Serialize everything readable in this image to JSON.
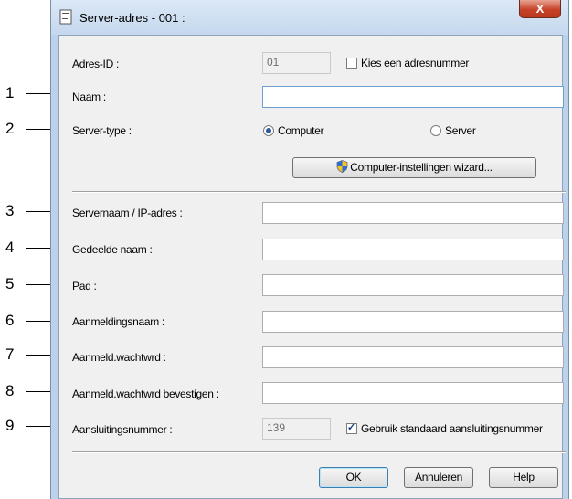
{
  "window": {
    "title": "Server-adres - 001 :",
    "close_label": "X"
  },
  "callouts": [
    "1",
    "2",
    "3",
    "4",
    "5",
    "6",
    "7",
    "8",
    "9"
  ],
  "form": {
    "adres_id_label": "Adres-ID :",
    "adres_id_value": "01",
    "kies_label": "Kies een adresnummer",
    "kies_checked": false,
    "naam_label": "Naam :",
    "naam_value": "",
    "servertype_label": "Server-type :",
    "radio_computer": "Computer",
    "radio_server": "Server",
    "selected_type": "Computer",
    "wizard_button": "Computer-instellingen wizard...",
    "servernaam_label": "Servernaam / IP-adres :",
    "gedeelde_label": "Gedeelde naam :",
    "pad_label": "Pad :",
    "aanmeldnaam_label": "Aanmeldingsnaam :",
    "wachtwrd_label": "Aanmeld.wachtwrd :",
    "bevestigen_label": "Aanmeld.wachtwrd bevestigen :",
    "poort_label": "Aansluitingsnummer :",
    "poort_value": "139",
    "standaard_label": "Gebruik standaard aansluitingsnummer",
    "standaard_checked": true
  },
  "buttons": {
    "ok": "OK",
    "annuleren": "Annuleren",
    "help": "Help"
  }
}
